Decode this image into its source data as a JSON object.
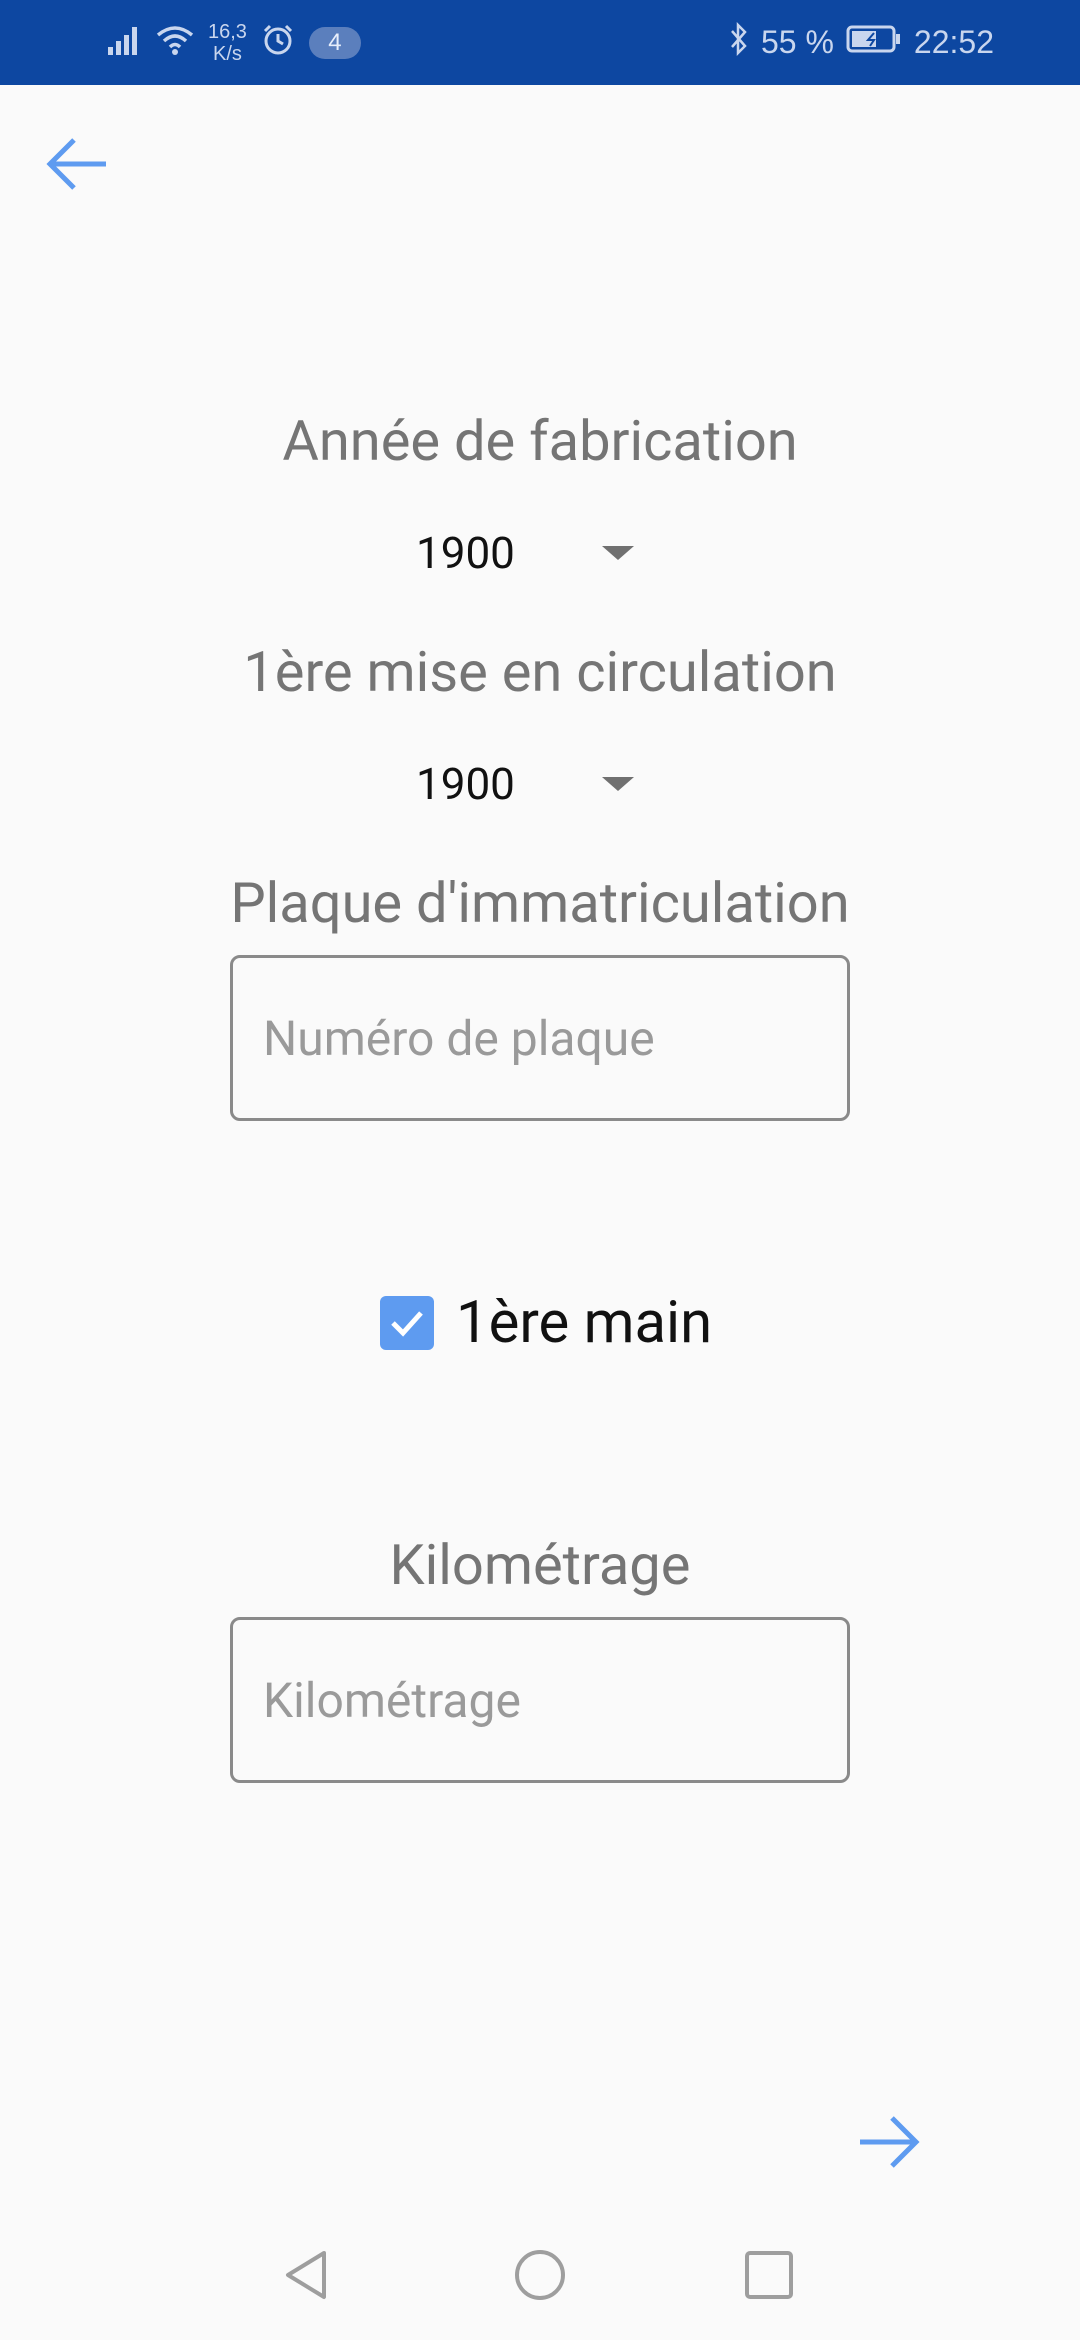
{
  "status_bar": {
    "network_speed": "16,3",
    "network_unit": "K/s",
    "notification_count": "4",
    "battery": "55 %",
    "time": "22:52",
    "icons": [
      "signal-icon",
      "wifi-icon",
      "alarm-icon",
      "bluetooth-icon",
      "battery-icon"
    ]
  },
  "toolbar": {
    "back_icon": "arrow-left-icon"
  },
  "form": {
    "year_label": "Année de fabrication",
    "year_value": "1900",
    "first_registration_label": "1ère mise en circulation",
    "first_registration_value": "1900",
    "plate_label": "Plaque d'immatriculation",
    "plate_placeholder": "Numéro de plaque",
    "plate_value": "",
    "first_hand_label": "1ère main",
    "first_hand_checked": true,
    "mileage_label": "Kilométrage",
    "mileage_placeholder": "Kilométrage",
    "mileage_value": ""
  },
  "navigation": {
    "next_icon": "arrow-right-icon"
  },
  "nav_bar": {
    "buttons": [
      "back-triangle-icon",
      "home-circle-icon",
      "recents-square-icon"
    ]
  },
  "colors": {
    "status_bar": "#0d47a1",
    "accent": "#5e9bf0",
    "label": "#757575",
    "background": "#fafafa"
  }
}
